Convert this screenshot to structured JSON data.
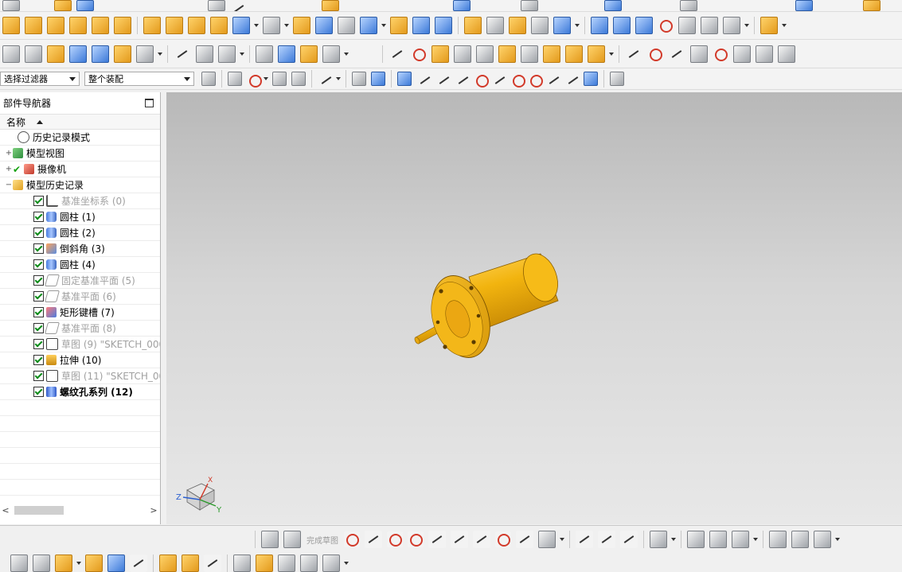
{
  "toolbar": {
    "filter_dropdown": "选择过滤器",
    "assembly_dropdown": "整个装配"
  },
  "navigator": {
    "title": "部件导航器",
    "column_name": "名称",
    "items": [
      {
        "label": "历史记录模式",
        "icon": "clock-icon"
      },
      {
        "label": "模型视图",
        "icon": "model-view-icon"
      },
      {
        "label": "摄像机",
        "icon": "camera-icon"
      },
      {
        "label": "模型历史记录",
        "icon": "folder-icon"
      },
      {
        "label": "基准坐标系 (0)",
        "icon": "datum-csys-icon"
      },
      {
        "label": "圆柱 (1)",
        "icon": "cylinder-icon"
      },
      {
        "label": "圆柱 (2)",
        "icon": "cylinder-icon"
      },
      {
        "label": "倒斜角 (3)",
        "icon": "chamfer-icon"
      },
      {
        "label": "圆柱 (4)",
        "icon": "cylinder-icon"
      },
      {
        "label": "固定基准平面 (5)",
        "icon": "datum-plane-icon"
      },
      {
        "label": "基准平面 (6)",
        "icon": "datum-plane-icon"
      },
      {
        "label": "矩形键槽 (7)",
        "icon": "slot-icon"
      },
      {
        "label": "基准平面 (8)",
        "icon": "datum-plane-icon"
      },
      {
        "label": "草图 (9) \"SKETCH_000",
        "icon": "sketch-icon"
      },
      {
        "label": "拉伸 (10)",
        "icon": "extrude-icon"
      },
      {
        "label": "草图 (11) \"SKETCH_00",
        "icon": "sketch-icon"
      },
      {
        "label": "螺纹孔系列 (12)",
        "icon": "threaded-hole-icon"
      }
    ]
  },
  "viewport": {
    "triad_x": "X",
    "triad_y": "Y",
    "triad_z": "Z",
    "part_color": "#f2b40f"
  },
  "sketch_toolbar": {
    "finish_sketch": "完成草图"
  }
}
